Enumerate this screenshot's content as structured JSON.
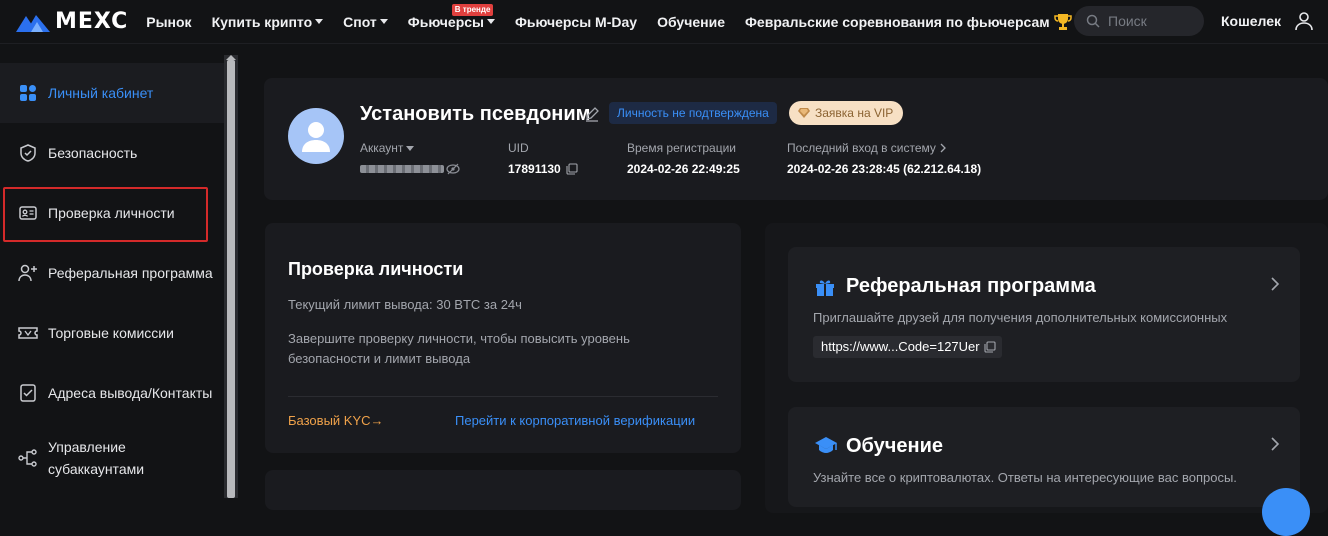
{
  "header": {
    "logo": "MEXC",
    "nav": [
      {
        "label": "Рынок",
        "caret": false
      },
      {
        "label": "Купить крипто",
        "caret": true
      },
      {
        "label": "Спот",
        "caret": true
      },
      {
        "label": "Фьючерсы",
        "caret": true,
        "badge": "В тренде"
      },
      {
        "label": "Фьючерсы M-Day",
        "caret": false
      },
      {
        "label": "Обучение",
        "caret": false
      },
      {
        "label": "Февральские соревнования по фьючерсам",
        "caret": false,
        "icon": "trophy-icon"
      }
    ],
    "search_placeholder": "Поиск",
    "wallet": "Кошелек"
  },
  "sidebar": {
    "items": [
      {
        "label": "Личный кабинет",
        "icon": "dashboard-icon",
        "active": true
      },
      {
        "label": "Безопасность",
        "icon": "shield-icon"
      },
      {
        "label": "Проверка личности",
        "icon": "id-card-icon"
      },
      {
        "label": "Реферальная программа",
        "icon": "add-user-icon"
      },
      {
        "label": "Торговые комиссии",
        "icon": "ticket-icon"
      },
      {
        "label": "Адреса вывода/Контакты",
        "icon": "address-book-icon"
      },
      {
        "label": "Управление субаккаунтами",
        "icon": "subaccount-icon"
      }
    ]
  },
  "profile": {
    "nickname": "Установить псевдоним",
    "badge_unverified": "Личность не подтверждена",
    "badge_vip": "Заявка на VIP",
    "account_label": "Аккаунт",
    "uid_label": "UID",
    "uid_value": "17891130",
    "reg_label": "Время регистрации",
    "reg_value": "2024-02-26 22:49:25",
    "last_login_label": "Последний вход в систему",
    "last_login_value": "2024-02-26 23:28:45 (62.212.64.18)"
  },
  "kyc": {
    "title": "Проверка личности",
    "limit": "Текущий лимит вывода: 30 BTC за 24ч",
    "description": "Завершите проверку личности, чтобы повысить уровень безопасности и лимит вывода",
    "basic_link": "Базовый KYC→",
    "corporate_link": "Перейти к корпоративной верификации"
  },
  "referral": {
    "title": "Реферальная программа",
    "description": "Приглашайте друзей для получения дополнительных комиссионных",
    "link": "https://www...Code=127Uer"
  },
  "education": {
    "title": "Обучение",
    "description": "Узнайте все о криптовалютах. Ответы на интересующие вас вопросы."
  },
  "colors": {
    "accent": "#3a8ff7",
    "kyc_basic": "#f0a24a",
    "highlight": "#d42a2a"
  }
}
